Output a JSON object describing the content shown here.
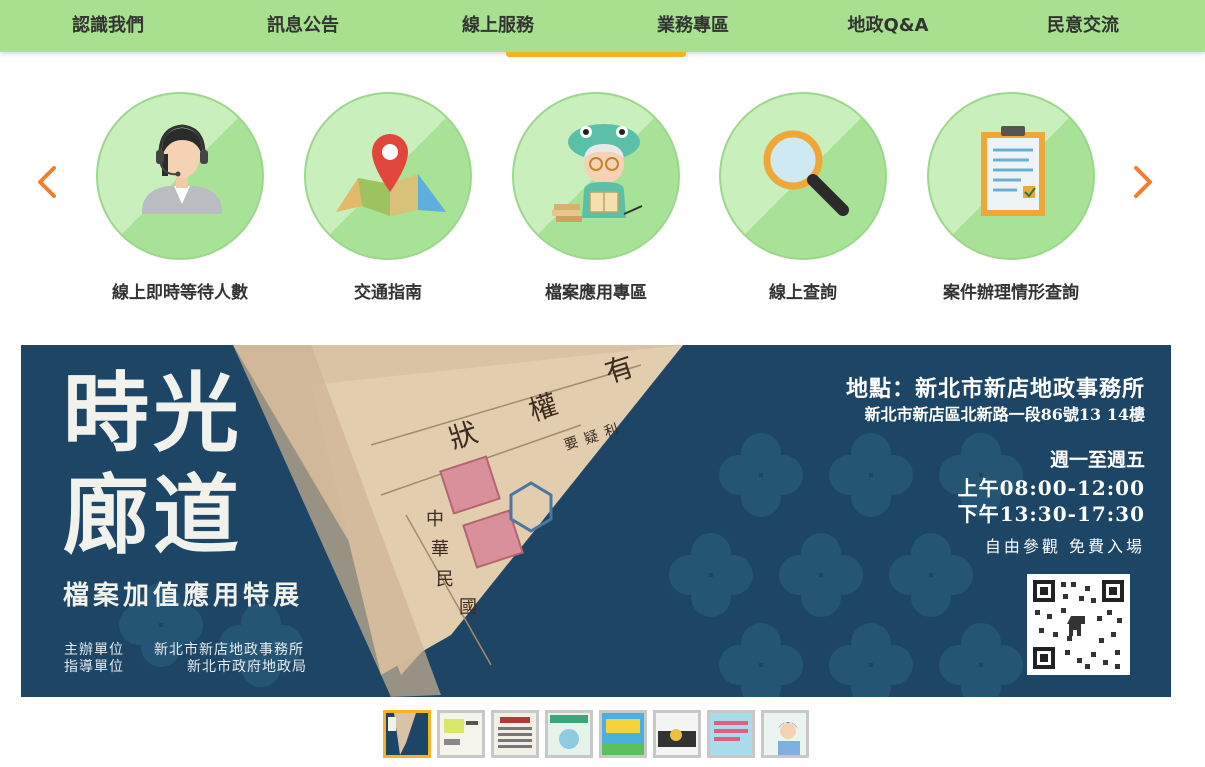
{
  "nav": {
    "items": [
      {
        "label": "認識我們"
      },
      {
        "label": "訊息公告"
      },
      {
        "label": "線上服務"
      },
      {
        "label": "業務專區"
      },
      {
        "label": "地政Q&A"
      },
      {
        "label": "民意交流"
      }
    ],
    "active_index": 2
  },
  "services": {
    "prev_icon": "chevron-left-icon",
    "next_icon": "chevron-right-icon",
    "items": [
      {
        "label": "線上即時等待人數",
        "icon": "customer-service-agent-icon"
      },
      {
        "label": "交通指南",
        "icon": "map-pin-icon"
      },
      {
        "label": "檔案應用專區",
        "icon": "archive-reader-icon"
      },
      {
        "label": "線上查詢",
        "icon": "magnifier-icon"
      },
      {
        "label": "案件辦理情形查詢",
        "icon": "clipboard-checklist-icon"
      }
    ]
  },
  "banner": {
    "title_line1": "時光",
    "title_line2": "廊道",
    "subtitle": "檔案加值應用特展",
    "organizer_label": "主辦單位",
    "organizer": "新北市新店地政事務所",
    "supervisor_label": "指導單位",
    "supervisor": "新北市政府地政局",
    "location": "地點：新北市新店地政事務所",
    "address": "新北市新店區北新路一段86號13 14樓",
    "days": "週一至週五",
    "morning": "上午08:00-12:00",
    "afternoon": "下午13:30-17:30",
    "admission": "自由參觀 免費入場",
    "document_chars": [
      "有",
      "權",
      "狀",
      "中",
      "華",
      "民",
      "國",
      "要",
      "疑",
      "利"
    ]
  },
  "thumbnails": {
    "count": 8,
    "active_index": 0
  },
  "colors": {
    "nav_bg": "#a8e090",
    "accent": "#f5b324",
    "arrow": "#f08030",
    "banner_bg": "#1d4565"
  }
}
